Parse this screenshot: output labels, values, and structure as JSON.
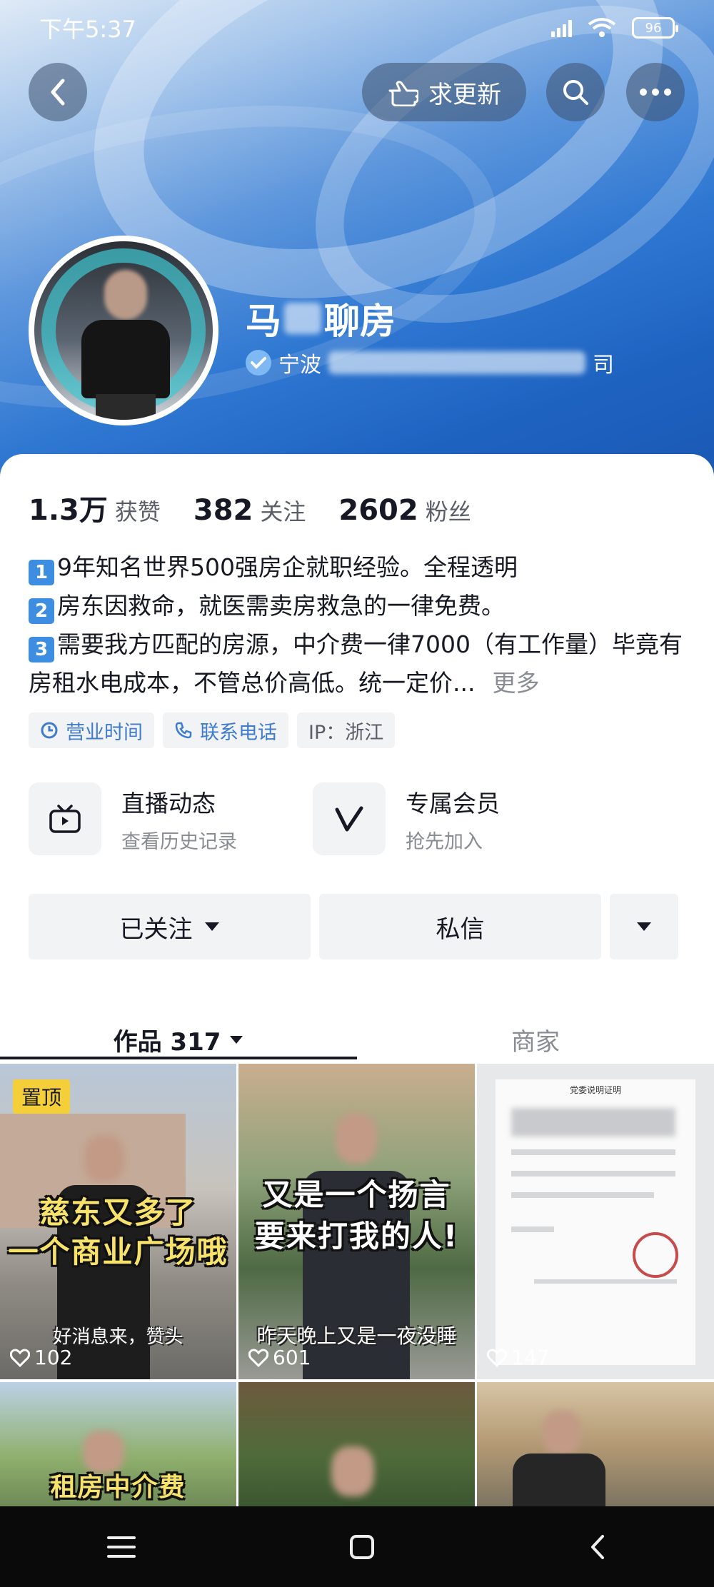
{
  "status_bar": {
    "time": "下午5:37",
    "battery": "96"
  },
  "header": {
    "update_label": "求更新"
  },
  "profile": {
    "name_prefix": "马",
    "name_suffix": "聊房",
    "verify_prefix": "宁波",
    "verify_suffix": "司"
  },
  "stats": [
    {
      "value": "1.3万",
      "label": "获赞"
    },
    {
      "value": "382",
      "label": "关注"
    },
    {
      "value": "2602",
      "label": "粉丝"
    }
  ],
  "bio": {
    "line1": "9年知名世界500强房企就职经验。全程透明",
    "line2": "房东因救命，就医需卖房救急的一律免费。",
    "line3": "需要我方匹配的房源，中介费一律7000（有工作量）毕竟有房租水电成本，不管总价高低。统一定价...",
    "more": "更多",
    "markers": [
      "1",
      "2",
      "3"
    ]
  },
  "tags": {
    "hours": "营业时间",
    "phone": "联系电话",
    "ip": "IP：浙江"
  },
  "features": [
    {
      "title": "直播动态",
      "subtitle": "查看历史记录",
      "icon": "tv-icon"
    },
    {
      "title": "专属会员",
      "subtitle": "抢先加入",
      "icon": "v-icon"
    }
  ],
  "actions": {
    "following": "已关注",
    "message": "私信"
  },
  "tabs": {
    "works": "作品 317",
    "merchant": "商家"
  },
  "videos": [
    {
      "pinned_label": "置顶",
      "caption1": "慈东又多了",
      "caption2": "一个商业广场哦",
      "subtitle": "好消息来，赞头",
      "likes": "102"
    },
    {
      "caption1": "又是一个扬言",
      "caption2": "要来打我的人!",
      "subtitle": "昨天晚上又是一夜没睡",
      "likes": "601"
    },
    {
      "doc_title": "党委说明证明",
      "likes": "147"
    },
    {
      "caption1": "租房中介费"
    },
    {},
    {}
  ],
  "colors": {
    "accent_blue": "#2f78d2",
    "link_blue": "#3f7ccf",
    "pin_yellow": "#f5cf3a"
  }
}
